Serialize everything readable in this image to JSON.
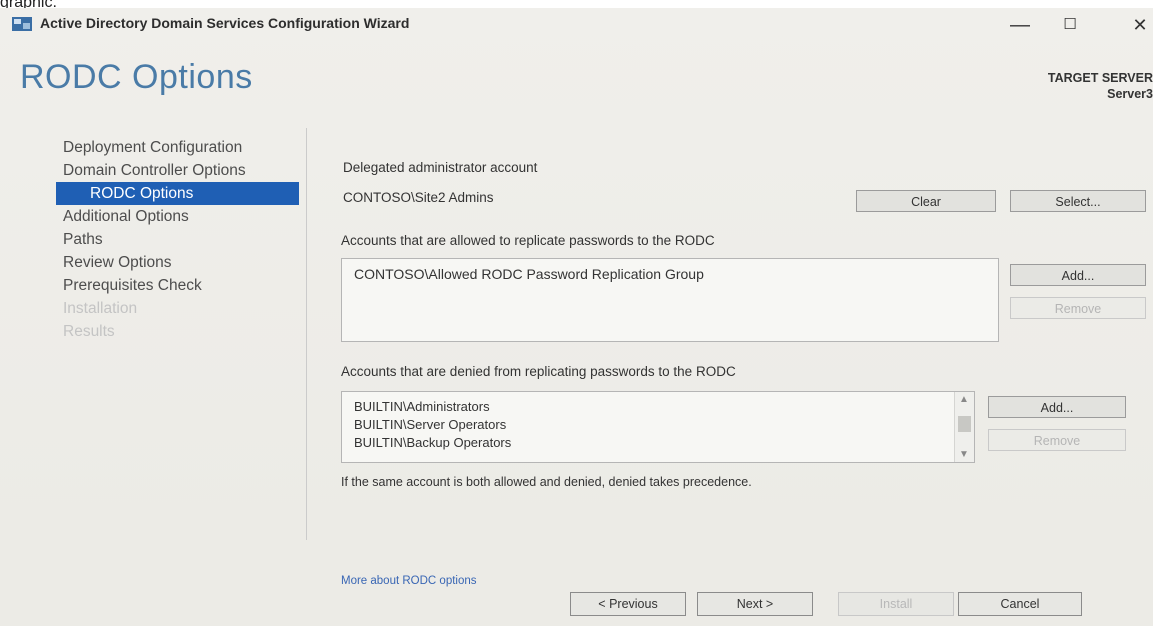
{
  "caption_fragment": "graphic.",
  "window": {
    "title": "Active Directory Domain Services Configuration Wizard",
    "minimize_glyph": "—",
    "maximize_glyph": "☐",
    "close_glyph": "✕"
  },
  "page": {
    "title": "RODC Options",
    "target_label": "TARGET SERVER",
    "target_value": "Server3"
  },
  "nav": {
    "items": [
      {
        "label": "Deployment Configuration"
      },
      {
        "label": "Domain Controller Options"
      },
      {
        "label": "RODC Options"
      },
      {
        "label": "Additional Options"
      },
      {
        "label": "Paths"
      },
      {
        "label": "Review Options"
      },
      {
        "label": "Prerequisites Check"
      },
      {
        "label": "Installation"
      },
      {
        "label": "Results"
      }
    ]
  },
  "delegated": {
    "label": "Delegated administrator account",
    "value": "CONTOSO\\Site2 Admins",
    "clear_button": "Clear",
    "select_button": "Select..."
  },
  "allowed": {
    "label": "Accounts that are allowed to replicate passwords to the RODC",
    "items": [
      "CONTOSO\\Allowed RODC Password Replication Group"
    ],
    "add_button": "Add...",
    "remove_button": "Remove"
  },
  "denied": {
    "label": "Accounts that are denied from replicating passwords to the RODC",
    "items": [
      "BUILTIN\\Administrators",
      "BUILTIN\\Server Operators",
      "BUILTIN\\Backup Operators"
    ],
    "add_button": "Add...",
    "remove_button": "Remove",
    "note": "If the same account is both allowed and denied, denied takes precedence."
  },
  "more_link": "More about RODC options",
  "footer": {
    "previous": "< Previous",
    "next": "Next >",
    "install": "Install",
    "cancel": "Cancel"
  },
  "colors": {
    "accent": "#1f5fb4",
    "title": "#4a7ba7",
    "link": "#3966b4"
  }
}
